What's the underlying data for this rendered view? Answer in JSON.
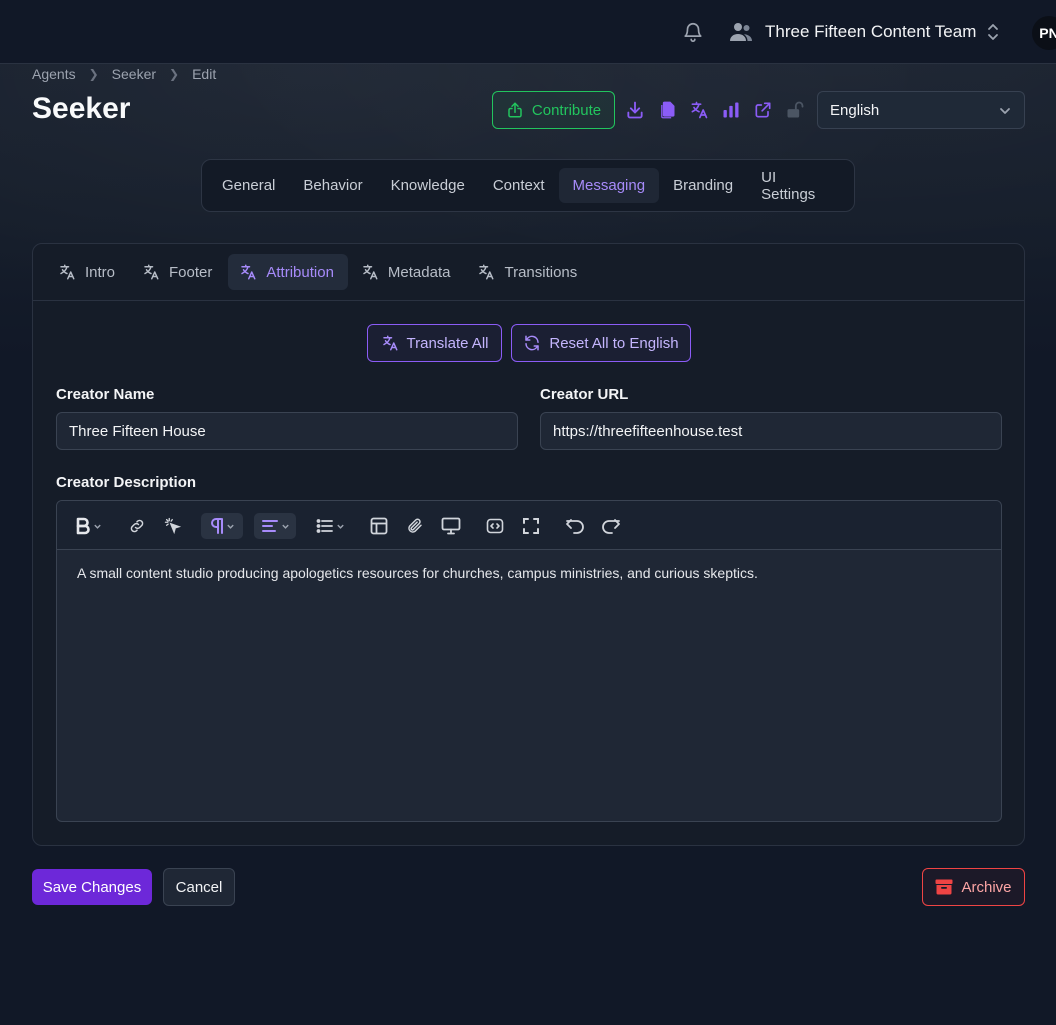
{
  "topbar": {
    "team_name": "Three Fifteen Content Team",
    "avatar_initials": "PN"
  },
  "breadcrumb": [
    "Agents",
    "Seeker",
    "Edit"
  ],
  "page_title": "Seeker",
  "actions": {
    "contribute_label": "Contribute",
    "language_selected": "English"
  },
  "main_tabs": [
    {
      "label": "General",
      "active": false
    },
    {
      "label": "Behavior",
      "active": false
    },
    {
      "label": "Knowledge",
      "active": false
    },
    {
      "label": "Context",
      "active": false
    },
    {
      "label": "Messaging",
      "active": true
    },
    {
      "label": "Branding",
      "active": false
    },
    {
      "label": "UI Settings",
      "active": false
    }
  ],
  "sub_tabs": [
    {
      "label": "Intro",
      "active": false
    },
    {
      "label": "Footer",
      "active": false
    },
    {
      "label": "Attribution",
      "active": true
    },
    {
      "label": "Metadata",
      "active": false
    },
    {
      "label": "Transitions",
      "active": false
    }
  ],
  "translate_all_label": "Translate All",
  "reset_all_label": "Reset All to English",
  "form": {
    "creator_name_label": "Creator Name",
    "creator_name_value": "Three Fifteen House",
    "creator_url_label": "Creator URL",
    "creator_url_value": "https://threefifteenhouse.test",
    "creator_description_label": "Creator Description",
    "creator_description_value": "A small content studio producing apologetics resources for churches, campus ministries, and curious skeptics."
  },
  "footer": {
    "save_label": "Save Changes",
    "cancel_label": "Cancel",
    "archive_label": "Archive"
  },
  "colors": {
    "accent": "#8b5cf6",
    "success": "#22c55e",
    "danger": "#ef4444",
    "primary_button": "#6d28d9"
  }
}
